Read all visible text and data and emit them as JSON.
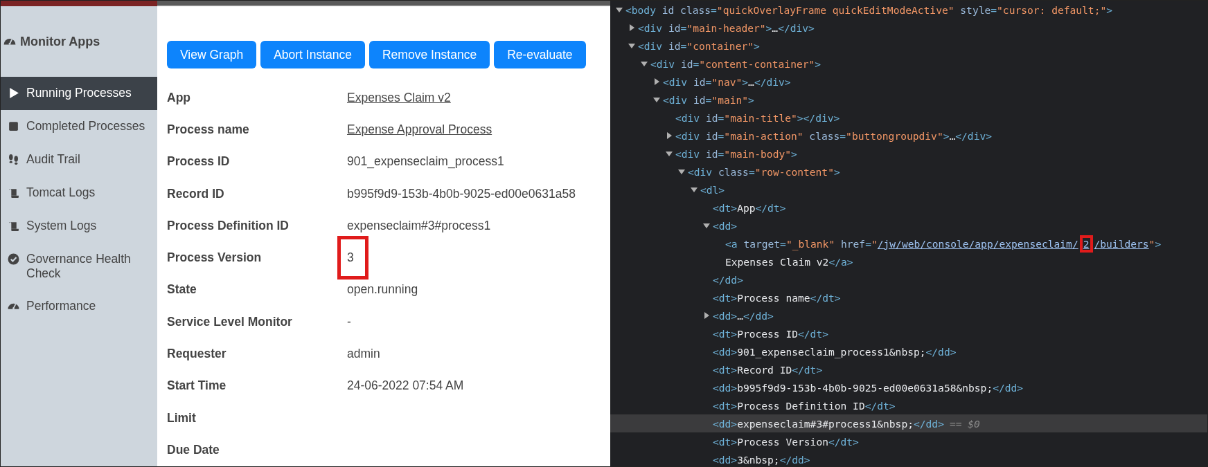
{
  "sidebar": {
    "title": "Monitor Apps",
    "items": [
      {
        "label": "Running Processes",
        "kind": "play",
        "selected": true
      },
      {
        "label": "Completed Processes",
        "kind": "square",
        "selected": false
      },
      {
        "label": "Audit Trail",
        "kind": "footprints",
        "selected": false
      },
      {
        "label": "Tomcat Logs",
        "kind": "scroll",
        "selected": false
      },
      {
        "label": "System Logs",
        "kind": "scroll",
        "selected": false
      },
      {
        "label": "Governance Health Check",
        "kind": "check",
        "selected": false
      },
      {
        "label": "Performance",
        "kind": "gauge",
        "selected": false
      }
    ]
  },
  "actions": [
    "View Graph",
    "Abort Instance",
    "Remove Instance",
    "Re-evaluate"
  ],
  "details": [
    {
      "label": "App",
      "value": "Expenses Claim v2",
      "kind": "link",
      "highlighted": false
    },
    {
      "label": "Process name",
      "value": "Expense Approval Process",
      "kind": "link",
      "highlighted": false
    },
    {
      "label": "Process ID",
      "value": "901_expenseclaim_process1",
      "kind": "text",
      "highlighted": false
    },
    {
      "label": "Record ID",
      "value": "b995f9d9-153b-4b0b-9025-ed00e0631a58",
      "kind": "text",
      "highlighted": false
    },
    {
      "label": "Process Definition ID",
      "value": "expenseclaim#3#process1",
      "kind": "text",
      "highlighted": false
    },
    {
      "label": "Process Version",
      "value": "3",
      "kind": "text",
      "highlighted": true
    },
    {
      "label": "State",
      "value": "open.running",
      "kind": "text",
      "highlighted": false
    },
    {
      "label": "Service Level Monitor",
      "value": "-",
      "kind": "text",
      "highlighted": false
    },
    {
      "label": "Requester",
      "value": "admin",
      "kind": "text",
      "highlighted": false
    },
    {
      "label": "Start Time",
      "value": "24-06-2022 07:54 AM",
      "kind": "text",
      "highlighted": false
    },
    {
      "label": "Limit"
    },
    {
      "label": "Due Date"
    }
  ],
  "devtools": {
    "nodes": [
      {
        "text": "<body id class=\"quickOverlayFrame quickEditModeActive\" style=\"cursor: default;\">",
        "expanded": true,
        "selected": false,
        "children": [
          {
            "text": "<div id=\"main-header\">…</div>",
            "expanded": false,
            "selected": false
          },
          {
            "text": "<div id=\"container\">",
            "expanded": true,
            "selected": false,
            "children": [
              {
                "text": "<div id=\"content-container\">",
                "expanded": true,
                "selected": false,
                "children": [
                  {
                    "text": "<div id=\"nav\">…</div>",
                    "expanded": false,
                    "selected": false
                  },
                  {
                    "text": "<div id=\"main\">",
                    "expanded": true,
                    "selected": false,
                    "children": [
                      {
                        "text": "<div id=\"main-title\"></div>",
                        "selected": false
                      },
                      {
                        "text": "<div id=\"main-action\" class=\"buttongroupdiv\">…</div>",
                        "expanded": false,
                        "selected": false
                      },
                      {
                        "text": "<div id=\"main-body\">",
                        "expanded": true,
                        "selected": false,
                        "children": [
                          {
                            "text": "<div class=\"row-content\">",
                            "expanded": true,
                            "selected": false,
                            "children": [
                              {
                                "text": "<dl>",
                                "expanded": true,
                                "selected": false,
                                "children": [
                                  {
                                    "text": "<dt>App</dt>",
                                    "selected": false
                                  },
                                  {
                                    "text": "<dd>",
                                    "expanded": true,
                                    "selected": false,
                                    "close": "</dd>",
                                    "children": [
                                      {
                                        "parts": [
                                          {
                                            "text": "<a target=\"_blank\" href=\""
                                          },
                                          {
                                            "text": "/jw/web/console/app/expenseclaim/",
                                            "kind": "link"
                                          },
                                          {
                                            "text": "2",
                                            "kind": "link",
                                            "boxed": true
                                          },
                                          {
                                            "text": "/builders",
                                            "kind": "link"
                                          },
                                          {
                                            "text": "\">"
                                          }
                                        ],
                                        "selected": false
                                      },
                                      {
                                        "text": "Expenses Claim v2</a>",
                                        "selected": false
                                      }
                                    ]
                                  },
                                  {
                                    "text": "<dt>Process name</dt>",
                                    "selected": false
                                  },
                                  {
                                    "text": "<dd>…</dd>",
                                    "expanded": false,
                                    "selected": false
                                  },
                                  {
                                    "text": "<dt>Process ID</dt>",
                                    "selected": false
                                  },
                                  {
                                    "text": "<dd>901_expenseclaim_process1&nbsp;</dd>",
                                    "selected": false
                                  },
                                  {
                                    "text": "<dt>Record ID</dt>",
                                    "selected": false
                                  },
                                  {
                                    "text": "<dd>b995f9d9-153b-4b0b-9025-ed00e0631a58&nbsp;</dd>",
                                    "selected": false
                                  },
                                  {
                                    "text": "<dt>Process Definition ID</dt>",
                                    "selected": false
                                  },
                                  {
                                    "text": "<dd>expenseclaim#3#process1&nbsp;</dd>",
                                    "selected": true,
                                    "marker": "== $0"
                                  },
                                  {
                                    "text": "<dt>Process Version</dt>",
                                    "selected": false
                                  },
                                  {
                                    "text": "<dd>3&nbsp;</dd>",
                                    "selected": false
                                  }
                                ]
                              }
                            ]
                          }
                        ]
                      }
                    ]
                  }
                ]
              }
            ]
          }
        ]
      }
    ]
  }
}
